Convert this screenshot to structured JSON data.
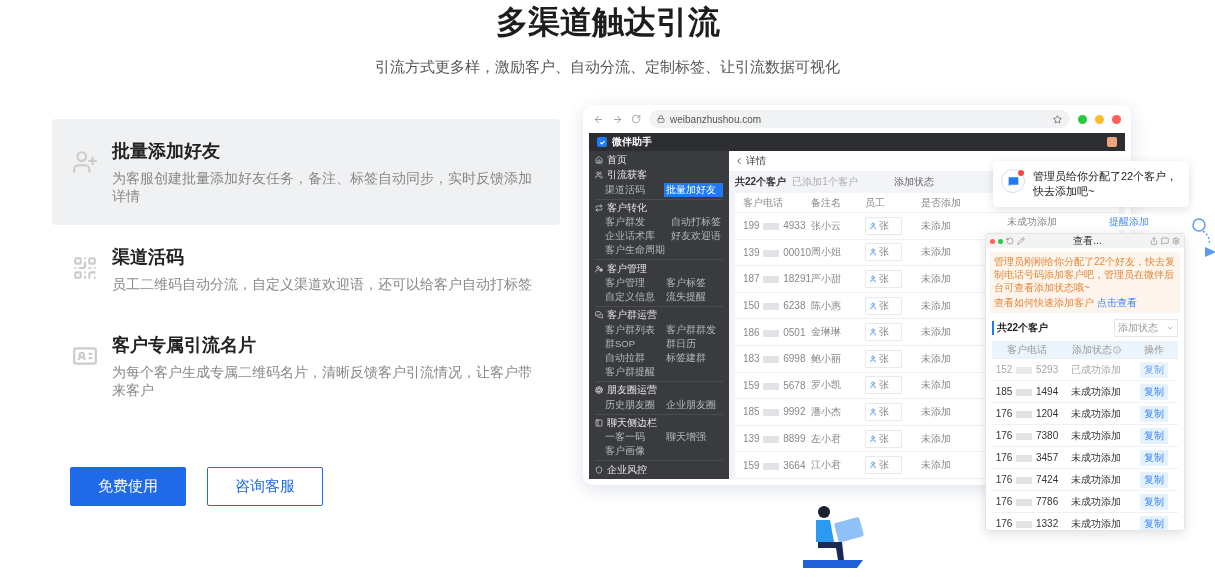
{
  "heading": "多渠道触达引流",
  "subheading": "引流方式更多样，激励客户、自动分流、定制标签、让引流数据可视化",
  "features": [
    {
      "kind": "add-user",
      "title": "批量添加好友",
      "desc": "为客服创建批量添加好友任务，备注、标签自动同步，实时反馈添加详情",
      "selected": true
    },
    {
      "kind": "qrcode",
      "title": "渠道活码",
      "desc": "员工二维码自动分流，自定义渠道欢迎语，还可以给客户自动打标签",
      "selected": false
    },
    {
      "kind": "card",
      "title": "客户专属引流名片",
      "desc": "为每个客户生成专属二维码名片，清晰反馈客户引流情况，让客户带来客户",
      "selected": false
    }
  ],
  "buttons": [
    {
      "label": "免费使用",
      "kind": "primary"
    },
    {
      "label": "咨询客服",
      "kind": "outline"
    }
  ],
  "mockup": {
    "url": "weibanzhushou.com",
    "app_title": "微伴助手",
    "sidebar": [
      {
        "label": "首页"
      },
      {
        "label": "引流获客",
        "children": [
          {
            "label": "渠道活码",
            "selected": false
          },
          {
            "label": "批量加好友",
            "selected": true
          }
        ]
      },
      {
        "label": "客户转化",
        "children": [
          {
            "label": "客户群发",
            "selected": false
          },
          {
            "label": "自动打标签",
            "selected": false
          },
          {
            "label": "企业话术库",
            "selected": false
          },
          {
            "label": "好友欢迎语",
            "selected": false
          },
          {
            "label": "客户生命周期",
            "selected": false
          }
        ]
      },
      {
        "label": "客户管理",
        "children": [
          {
            "label": "客户管理",
            "selected": false
          },
          {
            "label": "客户标签",
            "selected": false
          },
          {
            "label": "自定义信息",
            "selected": false
          },
          {
            "label": "流失提醒",
            "selected": false
          }
        ]
      },
      {
        "label": "客户群运营",
        "children": [
          {
            "label": "客户群列表",
            "selected": false
          },
          {
            "label": "客户群群发",
            "selected": false
          },
          {
            "label": "群SOP",
            "selected": false
          },
          {
            "label": "群日历",
            "selected": false
          },
          {
            "label": "自动拉群",
            "selected": false
          },
          {
            "label": "标签建群",
            "selected": false
          },
          {
            "label": "客户群提醒",
            "selected": false
          }
        ]
      },
      {
        "label": "朋友圈运营",
        "children": [
          {
            "label": "历史朋友圈",
            "selected": false
          },
          {
            "label": "企业朋友圈",
            "selected": false
          }
        ]
      },
      {
        "label": "聊天侧边栏",
        "children": [
          {
            "label": "一客一码",
            "selected": false
          },
          {
            "label": "聊天增强",
            "selected": false
          },
          {
            "label": "客户画像",
            "selected": false
          }
        ]
      },
      {
        "label": "企业风控"
      }
    ],
    "detail": {
      "title": "详情",
      "total": "共22个客户",
      "added": "已添加1个客户",
      "filter_label": "添加状态",
      "columns": [
        "客户电话",
        "备注名",
        "员工",
        "是否添加"
      ],
      "rows": [
        {
          "phone_start": "199",
          "phone_end": "4933",
          "remark": "张小云",
          "staff": "张",
          "status": "未添加"
        },
        {
          "phone_start": "139",
          "phone_end": "00010",
          "remark": "周小姐",
          "staff": "张",
          "status": "未添加"
        },
        {
          "phone_start": "187",
          "phone_end": "18291",
          "remark": "严小甜",
          "staff": "张",
          "status": "未添加"
        },
        {
          "phone_start": "150",
          "phone_end": "6238",
          "remark": "陈小惠",
          "staff": "张",
          "status": "未添加"
        },
        {
          "phone_start": "186",
          "phone_end": "0501",
          "remark": "金琳琳",
          "staff": "张",
          "status": "未添加"
        },
        {
          "phone_start": "183",
          "phone_end": "6998",
          "remark": "鲍小丽",
          "staff": "张",
          "status": "未添加"
        },
        {
          "phone_start": "159",
          "phone_end": "5678",
          "remark": "罗小凯",
          "staff": "张",
          "status": "未添加"
        },
        {
          "phone_start": "185",
          "phone_end": "9992",
          "remark": "潘小杰",
          "staff": "张",
          "status": "未添加"
        },
        {
          "phone_start": "139",
          "phone_end": "8899",
          "remark": "左小君",
          "staff": "张",
          "status": "未添加"
        },
        {
          "phone_start": "159",
          "phone_end": "3664",
          "remark": "江小君",
          "staff": "张",
          "status": "未添加"
        }
      ],
      "hidden_row": {
        "status": "未成功添加",
        "action": "提醒添加"
      }
    },
    "notification": {
      "text": "管理员给你分配了22个客户，快去添加吧~",
      "unread": true
    },
    "popup": {
      "tab_title": "查看...",
      "notice": "管理员刚刚给你分配了22个好友，快去复制电话号码添加客户吧，管理员在微伴后台可查看添加状态哦~",
      "help": "查看如何快速添加客户",
      "help_link": "点击查看",
      "total": "共22个客户",
      "filter_placeholder": "添加状态",
      "columns": [
        "客户电话",
        "添加状态",
        "操作"
      ],
      "rows": [
        {
          "phone_start": "152",
          "phone_end": "5293",
          "status": "已成功添加",
          "done": true,
          "action": "复制"
        },
        {
          "phone_start": "185",
          "phone_end": "1494",
          "status": "未成功添加",
          "done": false,
          "action": "复制"
        },
        {
          "phone_start": "176",
          "phone_end": "1204",
          "status": "未成功添加",
          "done": false,
          "action": "复制"
        },
        {
          "phone_start": "176",
          "phone_end": "7380",
          "status": "未成功添加",
          "done": false,
          "action": "复制"
        },
        {
          "phone_start": "176",
          "phone_end": "3457",
          "status": "未成功添加",
          "done": false,
          "action": "复制"
        },
        {
          "phone_start": "176",
          "phone_end": "7424",
          "status": "未成功添加",
          "done": false,
          "action": "复制"
        },
        {
          "phone_start": "176",
          "phone_end": "7786",
          "status": "未成功添加",
          "done": false,
          "action": "复制"
        },
        {
          "phone_start": "176",
          "phone_end": "1332",
          "status": "未成功添加",
          "done": false,
          "action": "复制"
        }
      ]
    }
  }
}
